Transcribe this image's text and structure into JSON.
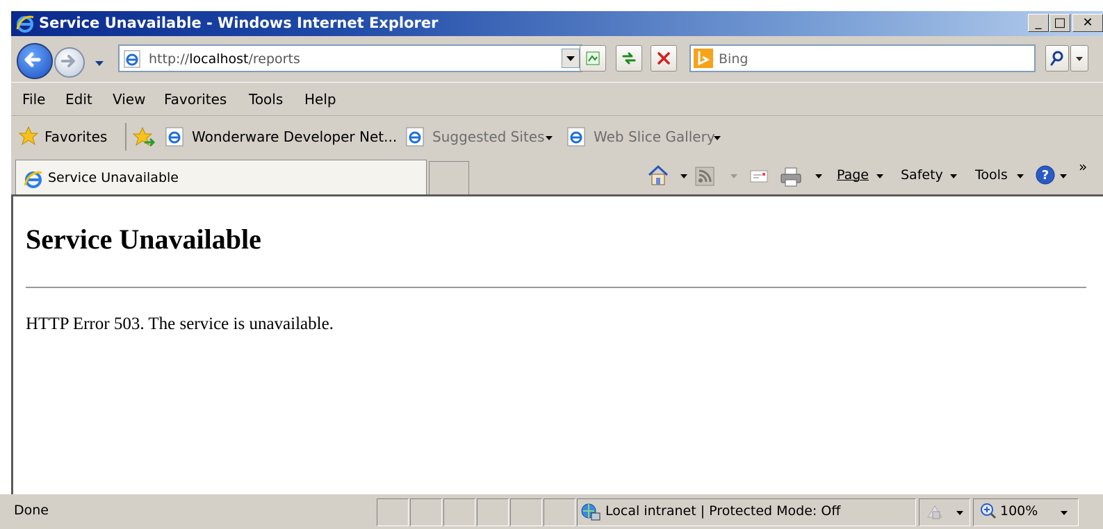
{
  "window": {
    "title": "Service Unavailable - Windows Internet Explorer",
    "minimize": "_",
    "maximize": "□",
    "close": "✕"
  },
  "address": {
    "prefix": "http://",
    "host": "localhost",
    "path": "/reports"
  },
  "search": {
    "placeholder": "Bing"
  },
  "menu": [
    "File",
    "Edit",
    "View",
    "Favorites",
    "Tools",
    "Help"
  ],
  "favorites": {
    "label": "Favorites",
    "items": [
      {
        "label": "Wonderware Developer Net..."
      },
      {
        "label": "Suggested Sites"
      },
      {
        "label": "Web Slice Gallery"
      }
    ]
  },
  "tab": {
    "label": "Service Unavailable"
  },
  "command_bar": {
    "page": "Page",
    "safety": "Safety",
    "tools": "Tools",
    "more": "»"
  },
  "content": {
    "heading": "Service Unavailable",
    "message": "HTTP Error 503. The service is unavailable."
  },
  "status": {
    "text": "Done",
    "zone": "Local intranet | Protected Mode: Off",
    "zoom": "100%"
  }
}
